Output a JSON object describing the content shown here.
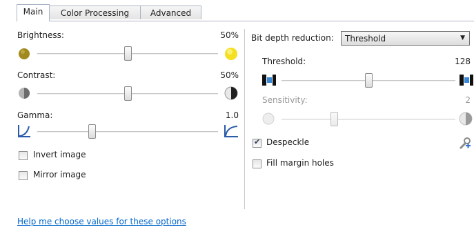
{
  "tabs": [
    "Main",
    "Color Processing",
    "Advanced"
  ],
  "left": {
    "brightness": {
      "label": "Brightness:",
      "value": "50%",
      "level": 0.5
    },
    "contrast": {
      "label": "Contrast:",
      "value": "50%",
      "level": 0.5
    },
    "gamma": {
      "label": "Gamma:",
      "value": "1.0",
      "level": 0.3
    },
    "invert_label": "Invert image",
    "mirror_label": "Mirror image",
    "help_link": "Help me choose values for these options"
  },
  "right": {
    "bit_depth_label": "Bit depth reduction:",
    "bit_depth_value": "Threshold",
    "threshold": {
      "label": "Threshold:",
      "value": "128",
      "level": 0.5
    },
    "sensitivity": {
      "label": "Sensitivity:",
      "value": "2",
      "level": 0.3,
      "enabled": false
    },
    "despeckle_label": "Despeckle",
    "despeckle_checked": true,
    "fill_margin_label": "Fill margin holes",
    "fill_margin_checked": false
  },
  "colors": {
    "link": "#0066cc",
    "brightness_dark": "#a08a20",
    "brightness_light": "#f4e020",
    "accent_blue": "#2f6fd0"
  }
}
